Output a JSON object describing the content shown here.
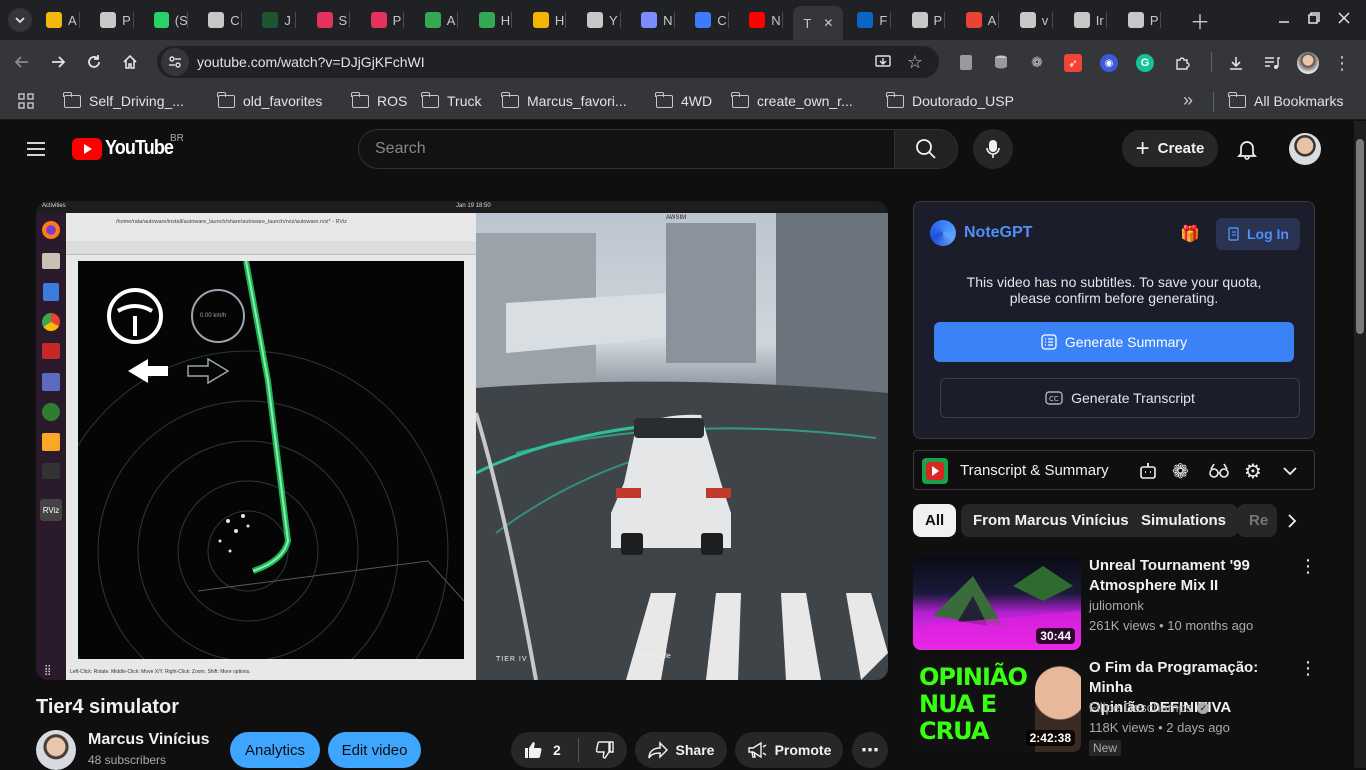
{
  "browser": {
    "tabs": [
      {
        "label": "A",
        "icon": "binance-icon",
        "color": "#f0b90b"
      },
      {
        "label": "P",
        "icon": "openai-icon",
        "color": "#c7c7c7"
      },
      {
        "label": "(S",
        "icon": "whatsapp-icon",
        "color": "#25d366"
      },
      {
        "label": "C",
        "icon": "github-copilot-icon",
        "color": "#c7c7c7"
      },
      {
        "label": "J",
        "icon": "j-icon",
        "color": "#1e5631"
      },
      {
        "label": "S",
        "icon": "s-icon",
        "color": "#e6325b"
      },
      {
        "label": "P",
        "icon": "p-icon",
        "color": "#e6325b"
      },
      {
        "label": "A",
        "icon": "google-drive-icon",
        "color": "#34a853"
      },
      {
        "label": "H",
        "icon": "google-drive-icon",
        "color": "#34a853"
      },
      {
        "label": "H",
        "icon": "slides-icon",
        "color": "#f4b400"
      },
      {
        "label": "Y",
        "icon": "chatgpt-icon",
        "color": "#c7c7c7"
      },
      {
        "label": "N",
        "icon": "hat-icon",
        "color": "#7b8cff"
      },
      {
        "label": "C",
        "icon": "zhihu-icon",
        "color": "#3d7bfd"
      },
      {
        "label": "N",
        "icon": "youtube-icon",
        "color": "#ff0000"
      },
      {
        "label": "T",
        "icon": "youtube-icon",
        "color": "#ff0000",
        "active": true
      },
      {
        "label": "F",
        "icon": "linkedin-icon",
        "color": "#0a66c2"
      },
      {
        "label": "P",
        "icon": "globe-icon",
        "color": "#c7c7c7"
      },
      {
        "label": "A",
        "icon": "gmail-icon",
        "color": "#ea4335"
      },
      {
        "label": "v",
        "icon": "github-icon",
        "color": "#c7c7c7"
      },
      {
        "label": "Ir",
        "icon": "globe-icon",
        "color": "#c7c7c7"
      },
      {
        "label": "P",
        "icon": "globe-icon",
        "color": "#c7c7c7"
      }
    ],
    "url": "youtube.com/watch?v=DJjGjKFchWI",
    "bookmarks": [
      "Self_Driving_...",
      "old_favorites",
      "ROS",
      "Truck",
      "Marcus_favori...",
      "4WD",
      "create_own_r...",
      "Doutorado_USP"
    ],
    "all_bookmarks": "All Bookmarks",
    "more_glyph": "»"
  },
  "youtube": {
    "logo_text": "YouTube",
    "country": "BR",
    "search_placeholder": "Search",
    "create_label": "Create",
    "video_title": "Tier4 simulator",
    "channel_name": "Marcus Vinícius",
    "subscribers": "48 subscribers",
    "analytics_label": "Analytics",
    "edit_video_label": "Edit video",
    "like_count": "2",
    "share_label": "Share",
    "promote_label": "Promote",
    "player_text": {
      "rviz_title": "/home/rata/autoware/install/autoware_launch/share/autoware_launch/rviz/autoware.rviz* - RViz",
      "activities": "Activities",
      "clock": "Jan 19  18:50",
      "awsim": "AWSIM",
      "speed": "0.00 km/h",
      "status": "Left-Click: Rotate. Middle-Click: Move X/Y. Right-Click: Zoom. Shift: More options.",
      "tier4": "TIER IV",
      "timescale": "Time Scale"
    }
  },
  "notegpt": {
    "brand": "NoteGPT",
    "login_label": "Log In",
    "message": "This video has no subtitles. To save your quota, please confirm before generating.",
    "generate_summary": "Generate Summary",
    "generate_transcript": "Generate Transcript",
    "transcript_summary": "Transcript & Summary"
  },
  "chips": [
    "All",
    "From Marcus Vinícius",
    "Simulations",
    "Re"
  ],
  "recommendations": [
    {
      "title_line1": "Unreal Tournament '99",
      "title_line2": "Atmosphere Mix II",
      "channel": "juliomonk",
      "meta": "261K views • 10 months ago",
      "duration": "30:44"
    },
    {
      "title_line1": "O Fim da Programação: Minha",
      "title_line2": "Opinião DEFINITIVA",
      "channel": "Filipe Deschamps",
      "meta": "118K views • 2 days ago",
      "duration": "2:42:38",
      "badge": "New",
      "thumb_text": "OPINIÃO NUA E CRUA"
    }
  ],
  "colors": {
    "accent_blue": "#3ea6ff",
    "notegpt_blue": "#3b82f6",
    "youtube_red": "#ff0000",
    "chrome_bg": "#202124"
  }
}
